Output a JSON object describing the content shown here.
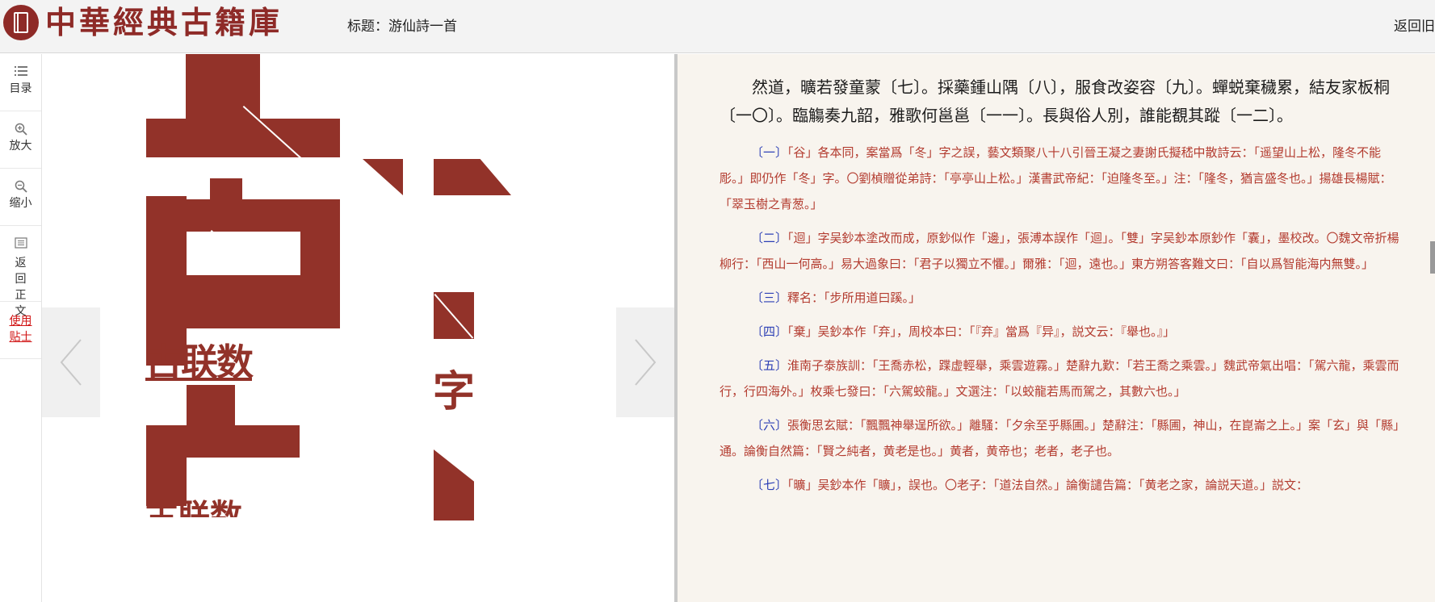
{
  "header": {
    "logo_text": "中華經典古籍庫",
    "title": "标题：游仙詩一首",
    "back_label": "返回旧"
  },
  "sidebar": {
    "items": [
      {
        "icon": "list-icon",
        "label": "目录"
      },
      {
        "icon": "zoom-in-icon",
        "label": "放大"
      },
      {
        "icon": "zoom-out-icon",
        "label": "缩小"
      },
      {
        "icon": "document-icon",
        "label": "返回正文"
      },
      {
        "icon": "",
        "label": "使用贴士"
      }
    ]
  },
  "viewer": {
    "image_text_1": "古联数",
    "image_text_2": "字",
    "image_text_3": "古联数"
  },
  "text": {
    "main": "然道，曠若發童蒙〔七〕。採藥鍾山隅〔八〕，服食改姿容〔九〕。蟬蜕棄穢累，結友家板桐〔一〇〕。臨觴奏九韶，雅歌何邕邕〔一一〕。長與俗人別，誰能覩其蹤〔一二〕。",
    "notes": [
      {
        "num": "〔一〕",
        "text": "「谷」各本同，案當爲「冬」字之誤，藝文類聚八十八引晉王凝之妻謝氏擬嵇中散詩云：「遥望山上松，隆冬不能彫。」即仍作「冬」字。〇劉楨贈從弟詩：「亭亭山上松。」漢書武帝紀：「迫隆冬至。」注：「隆冬，猶言盛冬也。」揚雄長楊賦：「翠玉樹之青葱。」"
      },
      {
        "num": "〔二〕",
        "text": "「迴」字吴鈔本塗改而成，原鈔似作「邊」，張溥本誤作「迴」。「雙」字吴鈔本原鈔作「囊」，墨校改。〇魏文帝折楊柳行：「西山一何高。」易大過象曰：「君子以獨立不懼。」爾雅：「迴，遠也。」東方朔答客難文曰：「自以爲智能海内無雙。」"
      },
      {
        "num": "〔三〕",
        "text": "釋名：「步所用道曰蹊。」"
      },
      {
        "num": "〔四〕",
        "text": "「棄」吴鈔本作「弃」，周校本曰：「『弃』當爲『异』，説文云：『舉也。』」"
      },
      {
        "num": "〔五〕",
        "text": "淮南子泰族訓：「王喬赤松，蹀虚輕舉，乘雲遊霧。」楚辭九歎：「若王喬之乘雲。」魏武帝氣出唱：「駕六龍，乘雲而行，行四海外。」枚乘七發曰：「六駕蛟龍。」文選注：「以蛟龍若馬而駕之，其數六也。」"
      },
      {
        "num": "〔六〕",
        "text": "張衡思玄賦：「飄飄神舉逞所欲。」離騷：「夕余至乎縣圃。」楚辭注：「縣圃，神山，在崑崙之上。」案「玄」與「縣」通。論衡自然篇：「賢之純者，黄老是也。」黄者，黄帝也；老者，老子也。"
      },
      {
        "num": "〔七〕",
        "text": "「曠」吴鈔本作「矌」，誤也。〇老子：「道法自然。」論衡譴告篇：「黄老之家，論説天道。」説文："
      }
    ]
  },
  "colors": {
    "brand": "#8e2a27",
    "note_text": "#b33b2f",
    "note_number": "#2c3fb5",
    "text_bg": "#f8f4ee"
  }
}
